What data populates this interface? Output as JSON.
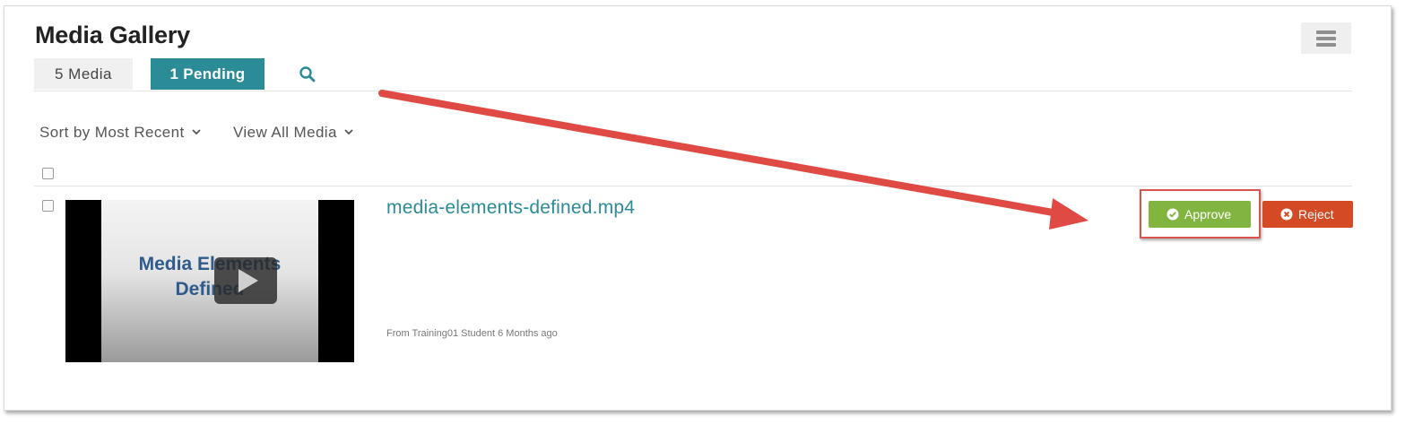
{
  "page": {
    "title": "Media Gallery"
  },
  "tabs": [
    {
      "label": "5 Media",
      "active": false
    },
    {
      "label": "1 Pending",
      "active": true
    }
  ],
  "toolbar": {
    "sort_label": "Sort by Most Recent",
    "filter_label": "View All Media"
  },
  "media_item": {
    "title": "media-elements-defined.mp4",
    "thumbnail_text_line1": "Media Elements",
    "thumbnail_text_line2": "Defined",
    "meta": "From Training01 Student 6 Months ago"
  },
  "actions": {
    "approve_label": "Approve",
    "reject_label": "Reject"
  },
  "colors": {
    "accent": "#2b8b97",
    "approve": "#82b53f",
    "reject": "#d44a24",
    "annotation": "#e04a44"
  },
  "icons": {
    "search": "search-icon",
    "menu": "list-menu-icon",
    "approve": "check-circle-icon",
    "reject": "x-circle-icon",
    "play": "play-icon",
    "chevron": "chevron-down-icon"
  }
}
